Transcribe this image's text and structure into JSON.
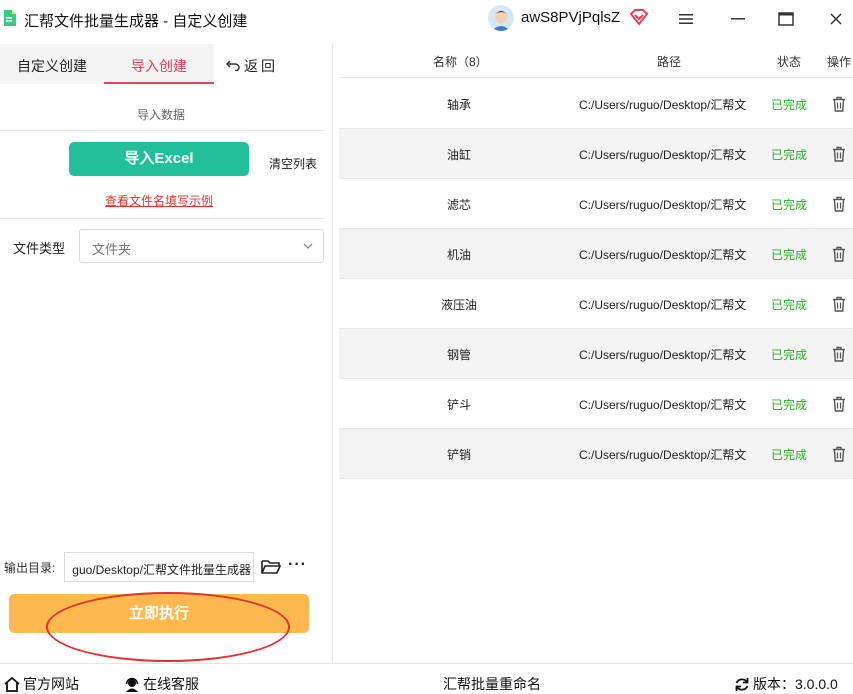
{
  "window": {
    "title": "汇帮文件批量生成器 - 自定义创建",
    "username": "awS8PVjPqlsZ",
    "controls": {
      "menu": "≡",
      "minimize": "—",
      "maximize": "☐",
      "close": "✕"
    }
  },
  "left": {
    "tabs": [
      "自定义创建",
      "导入创建",
      "返回"
    ],
    "active_tab": "导入创建",
    "import_section_label": "导入数据",
    "import_button": "导入Excel",
    "clear_list": "清空列表",
    "example_link": "查看文件名填写示例",
    "file_type_label": "文件类型",
    "file_type_value": "文件夹",
    "output_label": "输出目录:",
    "output_path": "guo/Desktop/汇帮文件批量生成器",
    "run_button": "立即执行"
  },
  "table": {
    "headers": {
      "name": "名称（8）",
      "path": "路径",
      "status": "状态",
      "action": "操作"
    },
    "rows": [
      {
        "name": "轴承",
        "path": "C:/Users/ruguo/Desktop/汇帮文",
        "status": "已完成"
      },
      {
        "name": "油缸",
        "path": "C:/Users/ruguo/Desktop/汇帮文",
        "status": "已完成"
      },
      {
        "name": "滤芯",
        "path": "C:/Users/ruguo/Desktop/汇帮文",
        "status": "已完成"
      },
      {
        "name": "机油",
        "path": "C:/Users/ruguo/Desktop/汇帮文",
        "status": "已完成"
      },
      {
        "name": "液压油",
        "path": "C:/Users/ruguo/Desktop/汇帮文",
        "status": "已完成"
      },
      {
        "name": "钢管",
        "path": "C:/Users/ruguo/Desktop/汇帮文",
        "status": "已完成"
      },
      {
        "name": "铲斗",
        "path": "C:/Users/ruguo/Desktop/汇帮文",
        "status": "已完成"
      },
      {
        "name": "铲销",
        "path": "C:/Users/ruguo/Desktop/汇帮文",
        "status": "已完成"
      }
    ]
  },
  "bottom": {
    "website": "官方网站",
    "support": "在线客服",
    "center": "汇帮批量重命名",
    "version": "版本：3.0.0.0"
  },
  "colors": {
    "accent_pink": "#e8405a",
    "import_green": "#23bf9a",
    "run_orange": "#ffb850",
    "status_green": "#2fa82f",
    "link_red": "#e3342f",
    "annotation_red": "#e52e2e"
  }
}
